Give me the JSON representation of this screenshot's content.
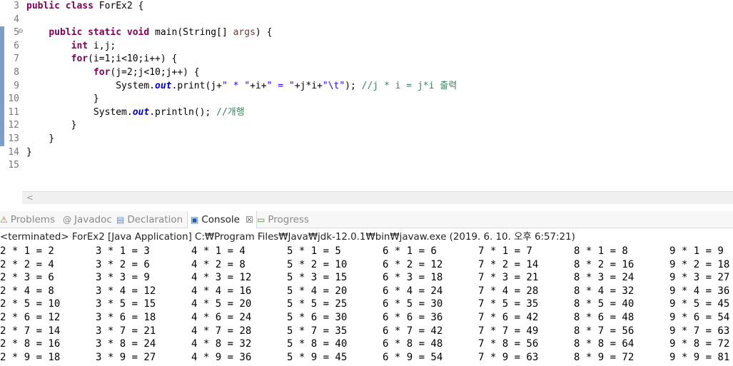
{
  "editor": {
    "line_numbers": [
      "3",
      "4",
      "5",
      "6",
      "7",
      "8",
      "9",
      "10",
      "11",
      "12",
      "13",
      "14",
      "15"
    ],
    "lines": [
      [
        {
          "t": "public class",
          "c": "kw"
        },
        {
          "t": " ForEx2 {"
        }
      ],
      [],
      [
        {
          "t": "    "
        },
        {
          "t": "public static void",
          "c": "kw"
        },
        {
          "t": " main(String[] "
        },
        {
          "t": "args",
          "c": "par"
        },
        {
          "t": ") {"
        }
      ],
      [
        {
          "t": "        "
        },
        {
          "t": "int",
          "c": "kw"
        },
        {
          "t": " i,j;"
        }
      ],
      [
        {
          "t": "        "
        },
        {
          "t": "for",
          "c": "kw"
        },
        {
          "t": "(i=1;i<10;i++) {"
        }
      ],
      [
        {
          "t": "            "
        },
        {
          "t": "for",
          "c": "kw"
        },
        {
          "t": "(j=2;j<10;j++) {"
        }
      ],
      [
        {
          "t": "                System."
        },
        {
          "t": "out",
          "c": "fld"
        },
        {
          "t": ".print(j+"
        },
        {
          "t": "\" * \"",
          "c": "str"
        },
        {
          "t": "+i+"
        },
        {
          "t": "\" = \"",
          "c": "str"
        },
        {
          "t": "+j*i+"
        },
        {
          "t": "\"\\t\"",
          "c": "str"
        },
        {
          "t": "); "
        },
        {
          "t": "//j * i = j*i 출력",
          "c": "cm"
        }
      ],
      [
        {
          "t": "            }"
        }
      ],
      [
        {
          "t": "            System."
        },
        {
          "t": "out",
          "c": "fld"
        },
        {
          "t": ".println(); "
        },
        {
          "t": "//개행",
          "c": "cm"
        }
      ],
      [
        {
          "t": "        }"
        }
      ],
      [
        {
          "t": "    }"
        }
      ],
      [
        {
          "t": "}"
        }
      ],
      []
    ],
    "fold_marker": "⊖",
    "scroll_left": "<"
  },
  "tabs": [
    {
      "id": "problems",
      "label": "Problems",
      "icon": "⚠",
      "icon_name": "problems-icon",
      "color": "#b07a12"
    },
    {
      "id": "javadoc",
      "label": "Javadoc",
      "icon": "@",
      "icon_name": "javadoc-icon",
      "color": "#8a8a8a"
    },
    {
      "id": "declaration",
      "label": "Declaration",
      "icon": "▤",
      "icon_name": "declaration-icon",
      "color": "#6b8fb5"
    },
    {
      "id": "console",
      "label": "Console",
      "icon": "▣",
      "icon_name": "console-icon",
      "color": "#2b5f9e",
      "close": "☒",
      "active": true
    },
    {
      "id": "progress",
      "label": "Progress",
      "icon": "▭",
      "icon_name": "progress-icon",
      "color": "#4f8a3a"
    }
  ],
  "console": {
    "status": "<terminated> ForEx2 [Java Application] C:₩Program Files₩Java₩jdk-12.0.1₩bin₩javaw.exe (2019. 6. 10. 오후 6:57:21)",
    "rows": [
      [
        "2 * 1 = 2",
        "3 * 1 = 3",
        "4 * 1 = 4",
        "5 * 1 = 5",
        "6 * 1 = 6",
        "7 * 1 = 7",
        "8 * 1 = 8",
        "9 * 1 = 9"
      ],
      [
        "2 * 2 = 4",
        "3 * 2 = 6",
        "4 * 2 = 8",
        "5 * 2 = 10",
        "6 * 2 = 12",
        "7 * 2 = 14",
        "8 * 2 = 16",
        "9 * 2 = 18"
      ],
      [
        "2 * 3 = 6",
        "3 * 3 = 9",
        "4 * 3 = 12",
        "5 * 3 = 15",
        "6 * 3 = 18",
        "7 * 3 = 21",
        "8 * 3 = 24",
        "9 * 3 = 27"
      ],
      [
        "2 * 4 = 8",
        "3 * 4 = 12",
        "4 * 4 = 16",
        "5 * 4 = 20",
        "6 * 4 = 24",
        "7 * 4 = 28",
        "8 * 4 = 32",
        "9 * 4 = 36"
      ],
      [
        "2 * 5 = 10",
        "3 * 5 = 15",
        "4 * 5 = 20",
        "5 * 5 = 25",
        "6 * 5 = 30",
        "7 * 5 = 35",
        "8 * 5 = 40",
        "9 * 5 = 45"
      ],
      [
        "2 * 6 = 12",
        "3 * 6 = 18",
        "4 * 6 = 24",
        "5 * 6 = 30",
        "6 * 6 = 36",
        "7 * 6 = 42",
        "8 * 6 = 48",
        "9 * 6 = 54"
      ],
      [
        "2 * 7 = 14",
        "3 * 7 = 21",
        "4 * 7 = 28",
        "5 * 7 = 35",
        "6 * 7 = 42",
        "7 * 7 = 49",
        "8 * 7 = 56",
        "9 * 7 = 63"
      ],
      [
        "2 * 8 = 16",
        "3 * 8 = 24",
        "4 * 8 = 32",
        "5 * 8 = 40",
        "6 * 8 = 48",
        "7 * 8 = 56",
        "8 * 8 = 64",
        "9 * 8 = 72"
      ],
      [
        "2 * 9 = 18",
        "3 * 9 = 27",
        "4 * 9 = 36",
        "5 * 9 = 45",
        "6 * 9 = 54",
        "7 * 9 = 63",
        "8 * 9 = 72",
        "9 * 9 = 81"
      ]
    ]
  },
  "colors": {
    "keyword": "#7f0055",
    "string": "#2a00ff",
    "comment": "#3f7f5f",
    "field": "#0000c0",
    "change_bar": "#7d9ec8"
  }
}
